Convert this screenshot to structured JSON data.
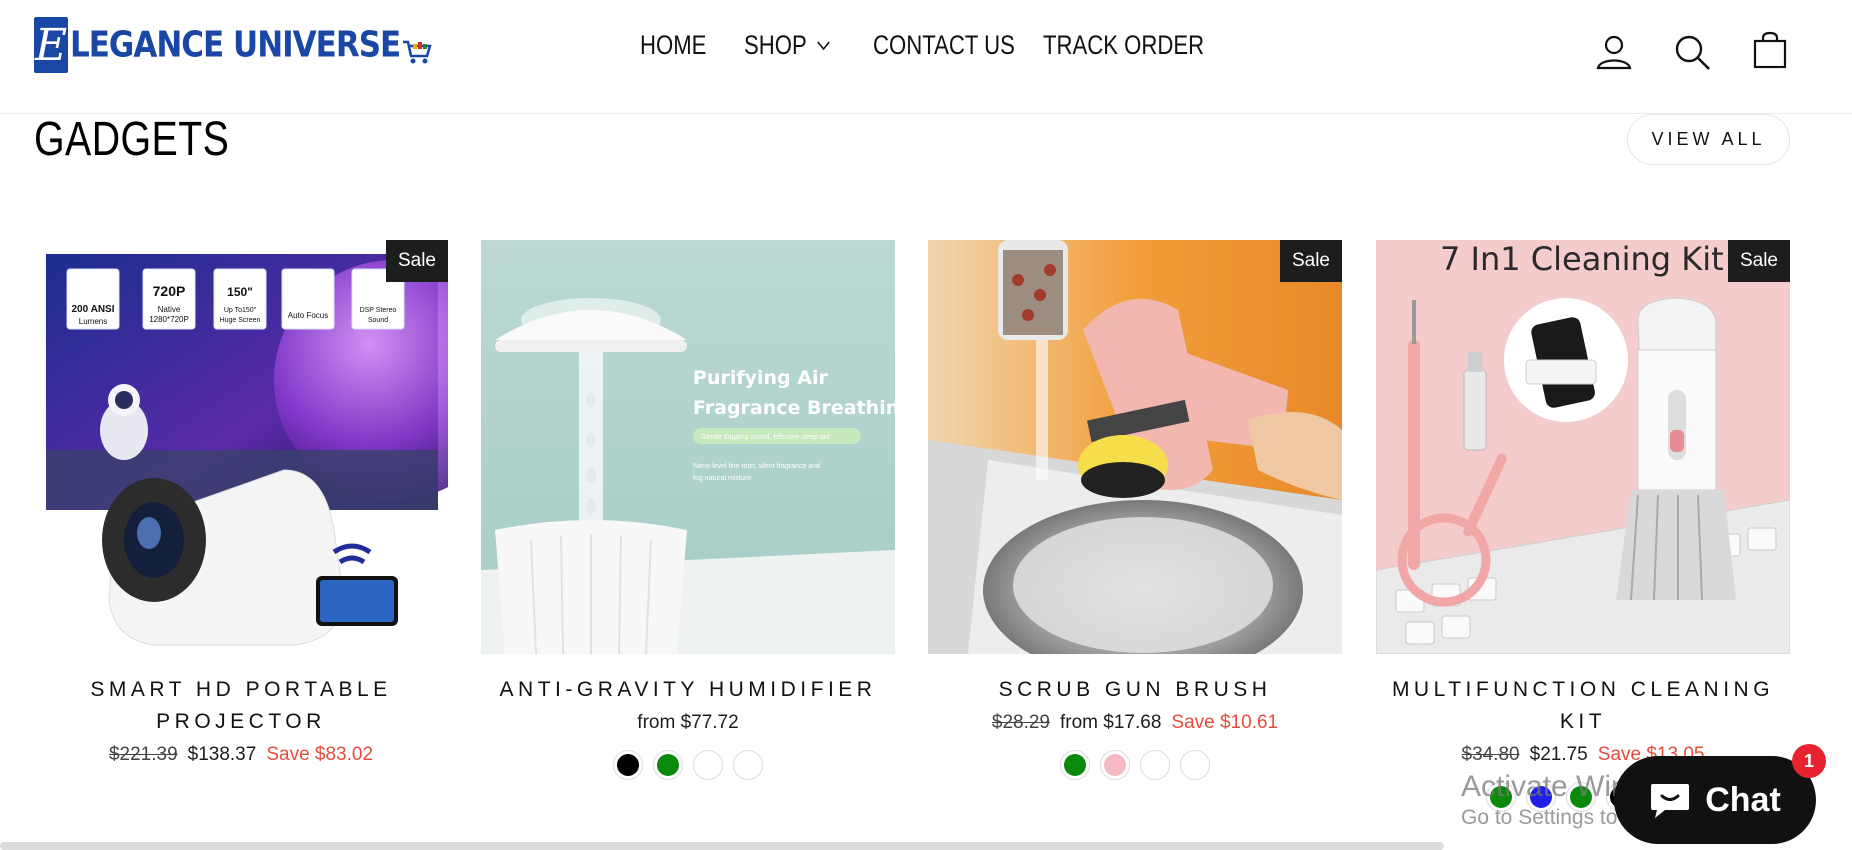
{
  "brand": {
    "mark": "E",
    "name": "LEGANCE UNIVERSE"
  },
  "nav": {
    "home": "HOME",
    "shop": "SHOP",
    "contact": "CONTACT US",
    "track": "TRACK ORDER"
  },
  "section": {
    "title": "GADGETS",
    "view_all": "VIEW ALL"
  },
  "products": [
    {
      "name": "SMART HD PORTABLE PROJECTOR",
      "sale_badge": "Sale",
      "old_price": "$221.39",
      "price": "$138.37",
      "save": "Save $83.02",
      "image_text": [
        "200 ANSI Lumens",
        "720P Native 1280*720P",
        "150\" Up To150\" Huge Screen",
        "Auto Focus",
        "DSP Stereo Sound"
      ],
      "swatches": []
    },
    {
      "name": "ANTI-GRAVITY HUMIDIFIER",
      "price": "from $77.72",
      "image_text": [
        "Purifying Air",
        "Fragrance Breathing",
        "Gentle dripping sound, effective sleep aid",
        "Nano-level fine mist, silent fragrance and",
        "fog natural mixture."
      ],
      "swatches": [
        "#000000",
        "#0a8a0a",
        "#ffffff",
        "#ffffff"
      ]
    },
    {
      "name": "SCRUB GUN BRUSH",
      "sale_badge": "Sale",
      "old_price": "$28.29",
      "price": "from $17.68",
      "save": "Save $10.61",
      "swatches": [
        "#0a8a0a",
        "#f7b9c4",
        "#ffffff",
        "#ffffff"
      ]
    },
    {
      "name": "MULTIFUNCTION CLEANING KIT",
      "sale_badge": "Sale",
      "old_price": "$34.80",
      "price": "$21.75",
      "save": "Save $13.05",
      "image_text": [
        "7 In1 Cleaning Kit"
      ],
      "swatches": [
        "#0a8a0a",
        "#1f1fe8",
        "#0a8a0a",
        "#000000"
      ]
    }
  ],
  "overlay": {
    "line1": "Activate Windows",
    "line2": "Go to Settings to activate Windows."
  },
  "chat": {
    "label": "Chat",
    "badge": "1"
  },
  "colors": {
    "brand": "#1a47a6",
    "sale_red": "#e74c3c",
    "badge_bg": "#1c1d1d"
  }
}
